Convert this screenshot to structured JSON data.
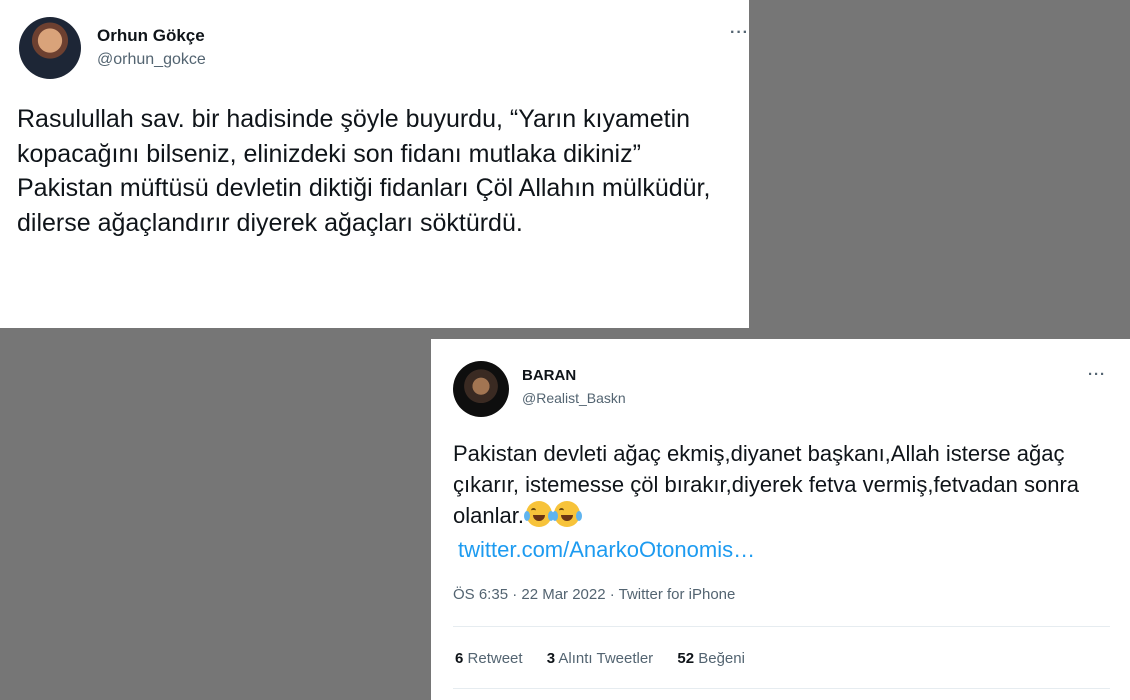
{
  "tweet1": {
    "author_name": "Orhun Gökçe",
    "author_handle": "@orhun_gokce",
    "more_label": "···",
    "text": "Rasulullah sav. bir hadisinde şöyle buyurdu, “Yarın kıyametin kopacağını bilseniz, elinizdeki son fidanı mutlaka dikiniz”\nPakistan müftüsü devletin diktiği fidanları Çöl Allahın mülküdür, dilerse ağaçlandırır diyerek ağaçları söktürdü."
  },
  "tweet2": {
    "author_name": "BARAN",
    "author_handle": "@Realist_Baskn",
    "more_label": "···",
    "text": "Pakistan devleti ağaç ekmiş,diyanet başkanı,Allah isterse ağaç çıkarır, istemesse çöl bırakır,diyerek fetva vermiş,fetvadan sonra olanlar.",
    "emoji_icons": [
      "face-with-tears-of-joy-icon",
      "face-with-tears-of-joy-icon"
    ],
    "link": "twitter.com/AnarkoOtonomis…",
    "timestamp": "ÖS 6:35 · 22 Mar 2022 · Twitter for iPhone",
    "stats": {
      "retweets_count": "6",
      "retweets_label": "Retweet",
      "quotes_count": "3",
      "quotes_label": "Alıntı Tweetler",
      "likes_count": "52",
      "likes_label": "Beğeni"
    }
  },
  "colors": {
    "background": "#767676",
    "link": "#1d9bf0",
    "secondary_text": "#536471"
  }
}
